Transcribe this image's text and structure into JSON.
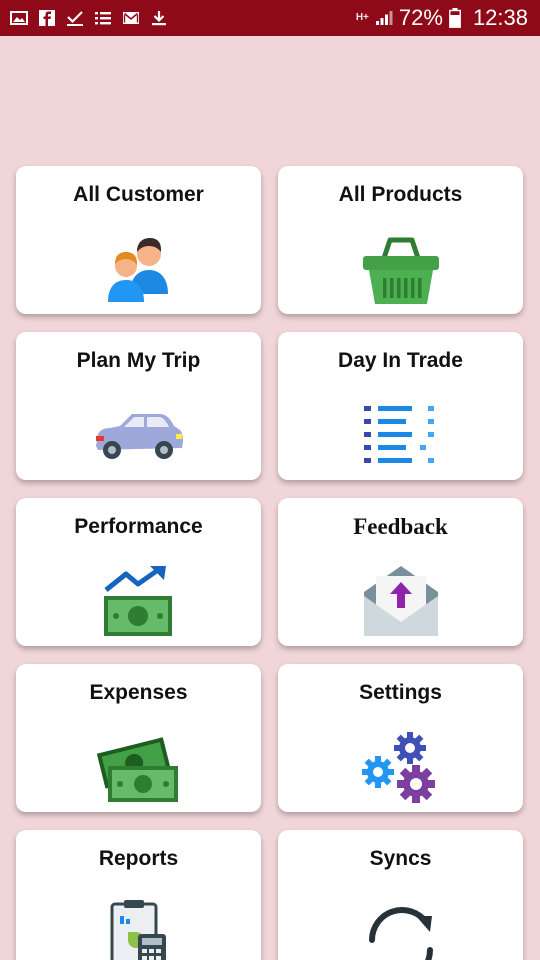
{
  "status_bar": {
    "left_icons": [
      "gallery-icon",
      "facebook-icon",
      "check-icon",
      "list-icon",
      "mail-icon",
      "download-icon"
    ],
    "network_label": "H+",
    "battery_percent": "72%",
    "time": "12:38",
    "background_color": "#8e0a18"
  },
  "page": {
    "background_color": "#f1d6d9"
  },
  "menu": {
    "items": [
      {
        "label": "All Customer",
        "icon": "customers-icon"
      },
      {
        "label": "All Products",
        "icon": "basket-icon"
      },
      {
        "label": "Plan My Trip",
        "icon": "car-icon"
      },
      {
        "label": "Day In Trade",
        "icon": "schedule-list-icon"
      },
      {
        "label": "Performance",
        "icon": "money-trend-icon"
      },
      {
        "label": "Feedback",
        "icon": "envelope-upload-icon"
      },
      {
        "label": "Expenses",
        "icon": "cash-icon"
      },
      {
        "label": "Settings",
        "icon": "gears-icon"
      },
      {
        "label": "Reports",
        "icon": "report-calculator-icon"
      },
      {
        "label": "Syncs",
        "icon": "sync-icon"
      }
    ]
  }
}
